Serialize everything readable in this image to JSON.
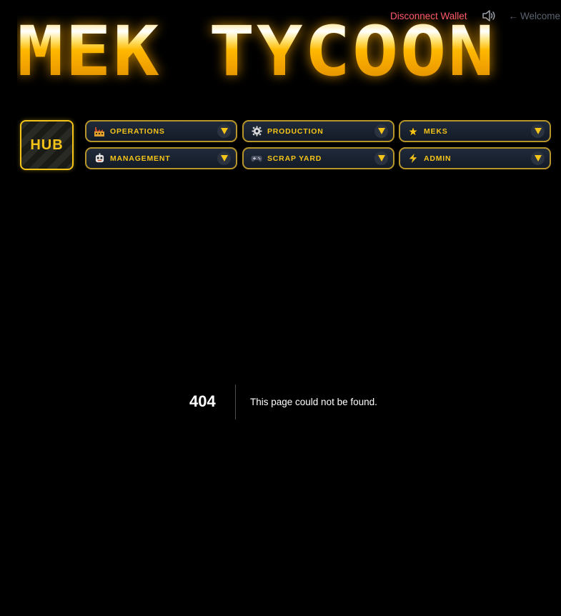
{
  "header": {
    "disconnect_label": "Disconnect Wallet",
    "sound_icon": "speaker-icon",
    "welcome_arrow": "←",
    "welcome_label": "Welcome"
  },
  "logo": {
    "text": "MEK TYCOON"
  },
  "hub": {
    "label": "HUB"
  },
  "nav": {
    "items": [
      {
        "label": "OPERATIONS",
        "icon": "factory-icon"
      },
      {
        "label": "PRODUCTION",
        "icon": "gear-icon"
      },
      {
        "label": "MEKS",
        "icon": "star-icon"
      },
      {
        "label": "MANAGEMENT",
        "icon": "robot-face-icon"
      },
      {
        "label": "SCRAP YARD",
        "icon": "gamepad-icon"
      },
      {
        "label": "ADMIN",
        "icon": "lightning-icon"
      }
    ]
  },
  "not_found": {
    "code": "404",
    "message": "This page could not be found."
  },
  "colors": {
    "accent": "#f5c418",
    "disconnect": "#ff5a6a",
    "nav_border": "#b8952a",
    "nav_bg": "#1a2230"
  }
}
